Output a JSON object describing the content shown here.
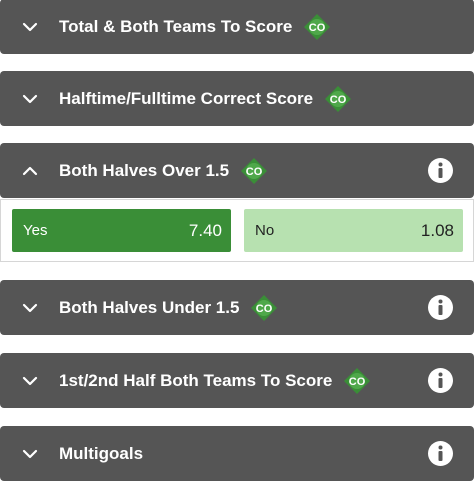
{
  "colors": {
    "header_bg": "#555555",
    "selected_green": "#3a8e37",
    "unselected_green": "#b7e1b0",
    "badge_green": "#3a8e37"
  },
  "markets": [
    {
      "title": "Total & Both Teams To Score",
      "badge": "CO",
      "expanded": false,
      "info": false,
      "chevron": "chevron-down-icon"
    },
    {
      "title": "Halftime/Fulltime Correct Score",
      "badge": "CO",
      "expanded": false,
      "info": false,
      "chevron": "chevron-down-icon"
    },
    {
      "title": "Both Halves Over 1.5",
      "badge": "CO",
      "expanded": true,
      "info": true,
      "chevron": "chevron-up-icon",
      "selections": [
        {
          "label": "Yes",
          "odds": "7.40",
          "selected": true
        },
        {
          "label": "No",
          "odds": "1.08",
          "selected": false
        }
      ]
    },
    {
      "title": "Both Halves Under 1.5",
      "badge": "CO",
      "expanded": false,
      "info": true,
      "chevron": "chevron-down-icon"
    },
    {
      "title": "1st/2nd Half Both Teams To Score",
      "badge": "CO",
      "expanded": false,
      "info": true,
      "chevron": "chevron-down-icon"
    },
    {
      "title": "Multigoals",
      "badge": "",
      "expanded": false,
      "info": true,
      "chevron": "chevron-down-icon"
    }
  ]
}
